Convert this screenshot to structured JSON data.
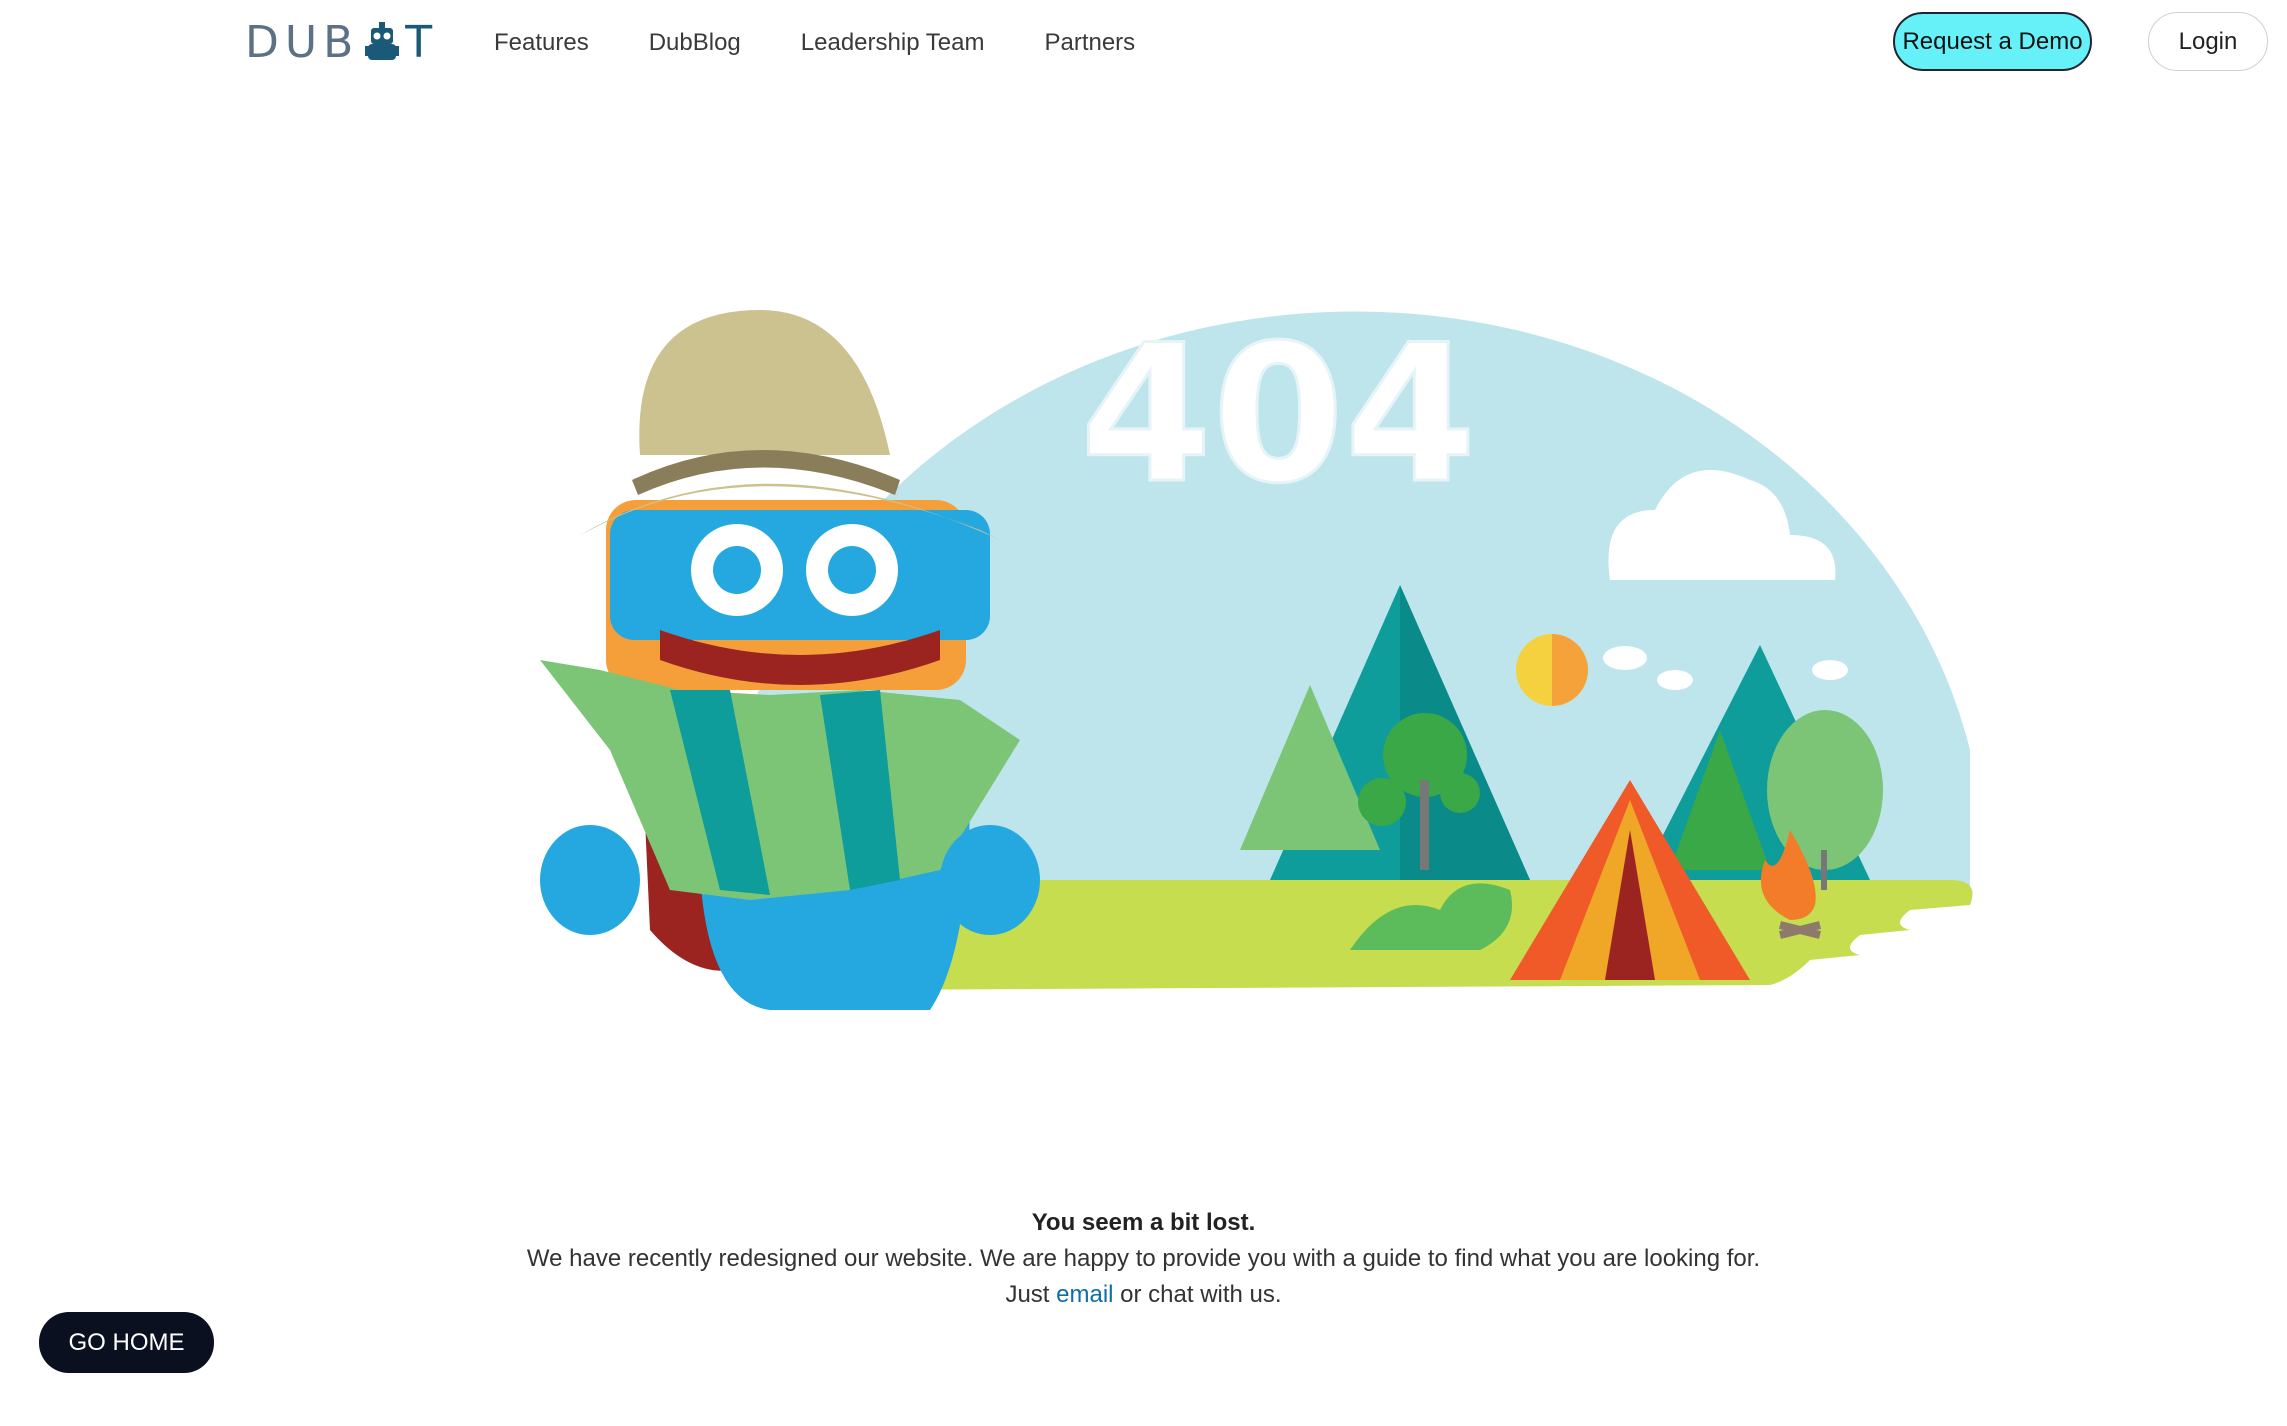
{
  "header": {
    "logo_left": "DUB",
    "logo_right": "T",
    "nav": [
      "Features",
      "DubBlog",
      "Leadership Team",
      "Partners"
    ],
    "demo_button": "Request a Demo",
    "login_button": "Login"
  },
  "illustration": {
    "error_code": "404",
    "icon": "lost-robot-404-illustration"
  },
  "message": {
    "heading": "You seem a bit lost.",
    "line1": "We have recently redesigned our website. We are happy to provide you with a guide to find what you are looking for.",
    "line2_prefix": "Just",
    "line2_link": "email",
    "line2_suffix": "or chat with us."
  },
  "go_home": "GO HOME",
  "colors": {
    "demo_bg": "#66f0f7",
    "sky": "#bee5ec",
    "grass": "#c5dd4e",
    "robot_blue": "#25a8e0",
    "home_button_bg": "#0b1020"
  }
}
